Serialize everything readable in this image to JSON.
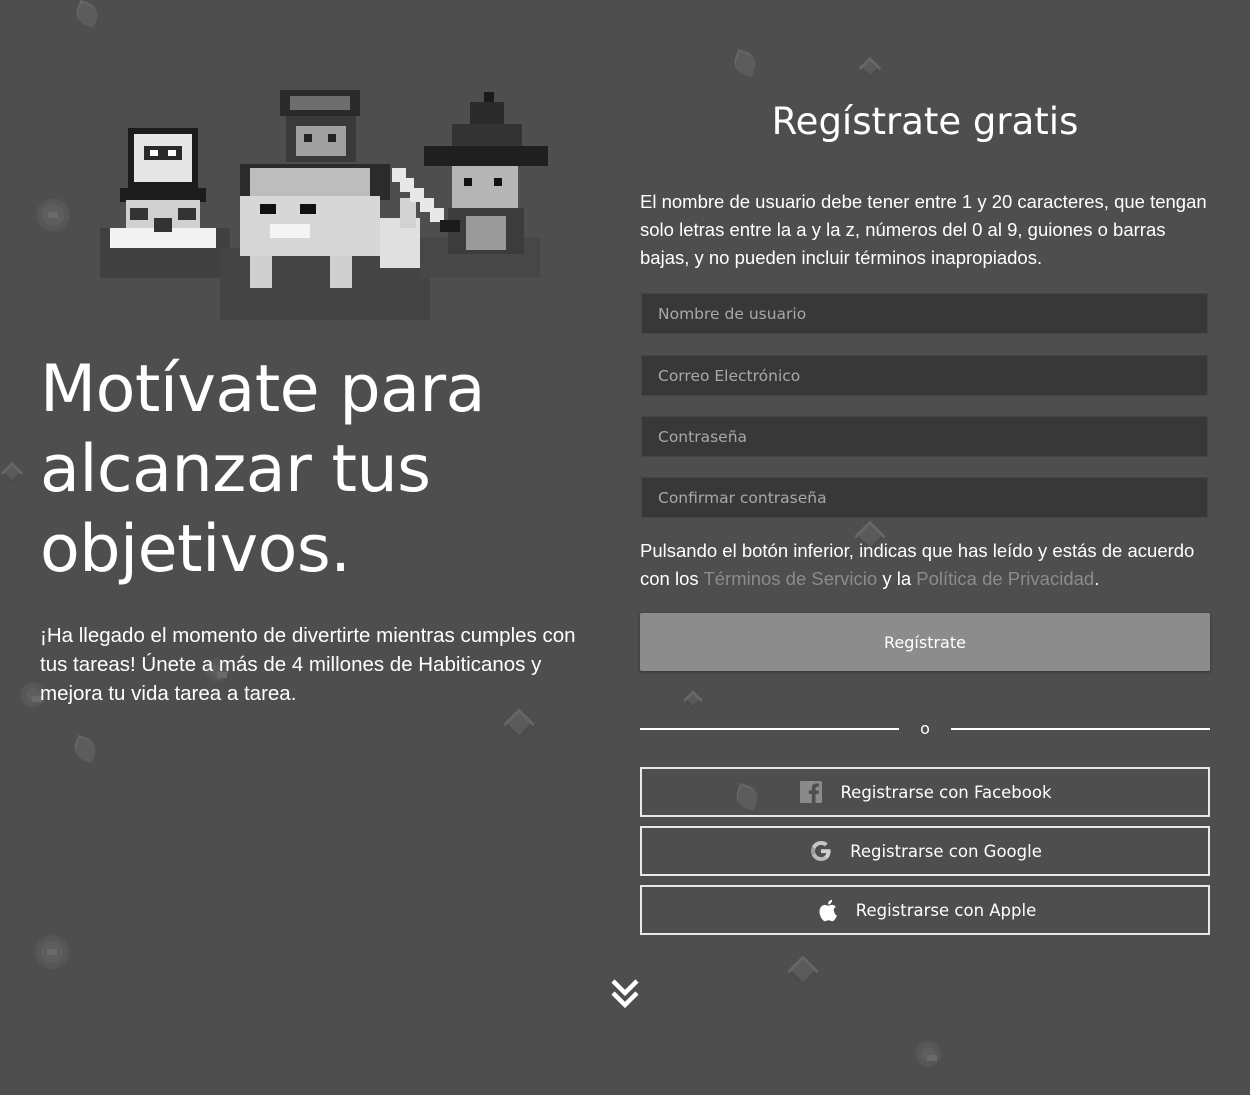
{
  "hero": {
    "headline": "Motívate para alcanzar tus objetivos.",
    "intro": "¡Ha llegado el momento de divertirte mientras cumples con tus tareas! Únete a más de 4 millones de Habiticanos y mejora tu vida tarea a tarea."
  },
  "signup": {
    "title": "Regístrate gratis",
    "rules": "El nombre de usuario debe tener entre 1 y 20 caracteres, que tengan solo letras entre la a y la z, números del 0 al 9, guiones o barras bajas, y no pueden incluir términos inapropiados.",
    "fields": {
      "username_placeholder": "Nombre de usuario",
      "email_placeholder": "Correo Electrónico",
      "password_placeholder": "Contraseña",
      "confirm_placeholder": "Confirmar contraseña"
    },
    "consent": {
      "prefix": "Pulsando el botón inferior, indicas que has leído y estás de acuerdo con los ",
      "terms_link": "Términos de Servicio",
      "middle": " y la ",
      "privacy_link": "Política de Privacidad",
      "suffix": "."
    },
    "submit_label": "Regístrate",
    "divider_label": "o",
    "social": {
      "facebook_label": "Registrarse con Facebook",
      "google_label": "Registrarse con Google",
      "apple_label": "Registrarse con Apple"
    }
  },
  "icons": {
    "scroll": "double-chevron-down-icon",
    "facebook": "facebook-icon",
    "google": "google-icon",
    "apple": "apple-icon"
  },
  "colors": {
    "background": "#4e4e4e",
    "input_bg": "#383838",
    "button_bg": "#8c8c8c",
    "link": "#8c8c8c"
  }
}
